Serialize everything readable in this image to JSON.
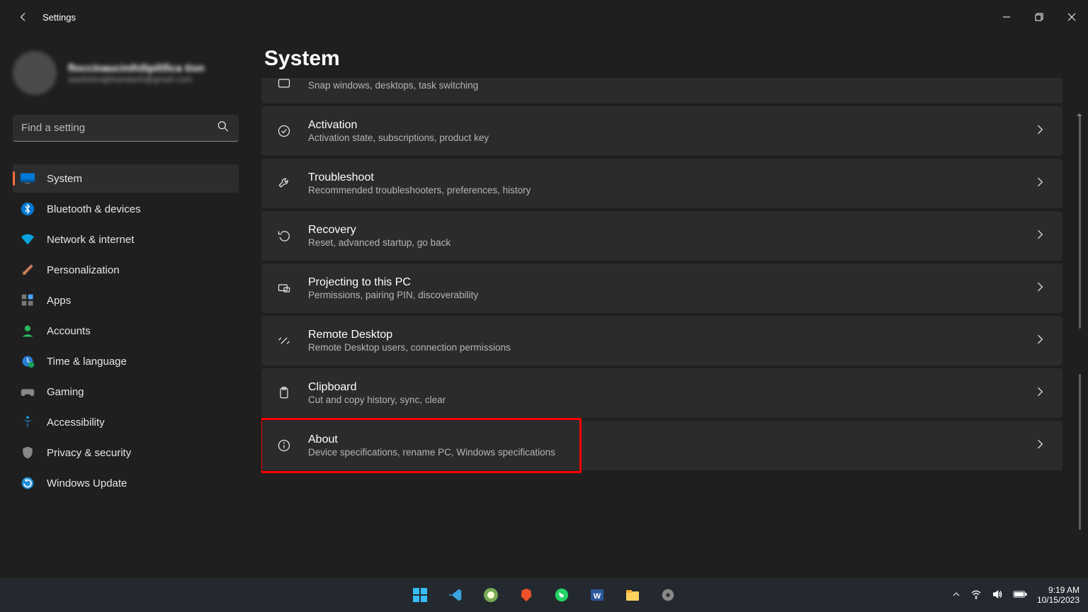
{
  "window": {
    "title": "Settings",
    "page_heading": "System"
  },
  "profile": {
    "name": "floccinaucinihilipilifica tion",
    "email": "aashishrajbhandari0@gmail.com"
  },
  "search": {
    "placeholder": "Find a setting"
  },
  "sidebar": {
    "items": [
      {
        "label": "System",
        "active": true
      },
      {
        "label": "Bluetooth & devices"
      },
      {
        "label": "Network & internet"
      },
      {
        "label": "Personalization"
      },
      {
        "label": "Apps"
      },
      {
        "label": "Accounts"
      },
      {
        "label": "Time & language"
      },
      {
        "label": "Gaming"
      },
      {
        "label": "Accessibility"
      },
      {
        "label": "Privacy & security"
      },
      {
        "label": "Windows Update"
      }
    ]
  },
  "main": {
    "partial_sub": "Snap windows, desktops, task switching",
    "rows": [
      {
        "title": "Activation",
        "sub": "Activation state, subscriptions, product key"
      },
      {
        "title": "Troubleshoot",
        "sub": "Recommended troubleshooters, preferences, history"
      },
      {
        "title": "Recovery",
        "sub": "Reset, advanced startup, go back"
      },
      {
        "title": "Projecting to this PC",
        "sub": "Permissions, pairing PIN, discoverability"
      },
      {
        "title": "Remote Desktop",
        "sub": "Remote Desktop users, connection permissions"
      },
      {
        "title": "Clipboard",
        "sub": "Cut and copy history, sync, clear"
      },
      {
        "title": "About",
        "sub": "Device specifications, rename PC, Windows specifications",
        "highlight": true
      }
    ]
  },
  "taskbar": {
    "time": "9:19 AM",
    "date": "10/15/2023"
  }
}
